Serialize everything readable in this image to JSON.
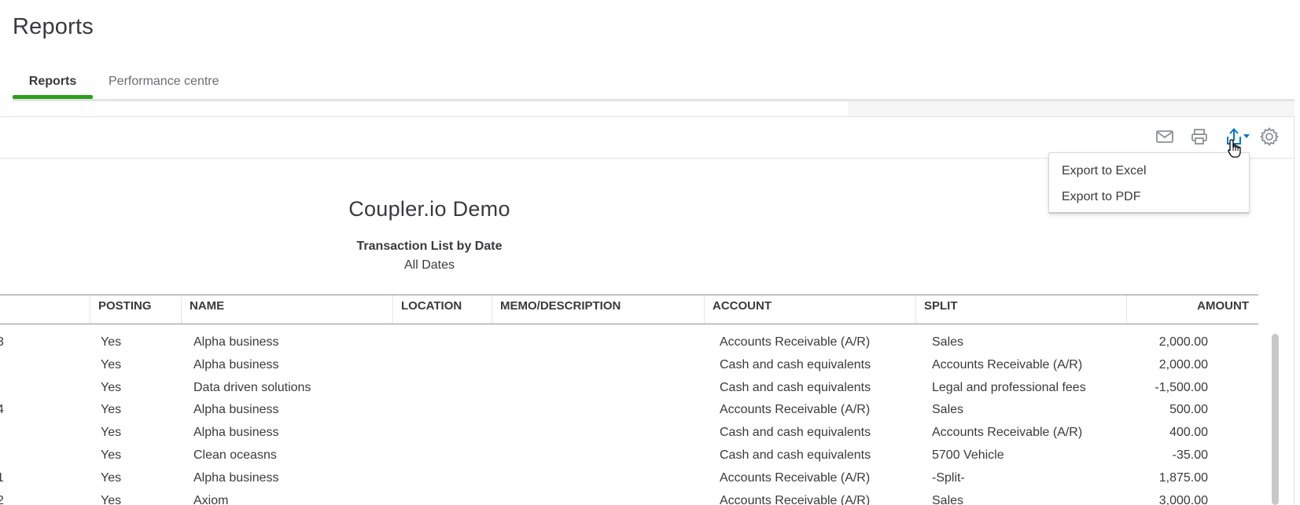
{
  "header": {
    "title": "Reports"
  },
  "tabs": [
    {
      "label": "Reports",
      "active": true
    },
    {
      "label": "Performance centre",
      "active": false
    }
  ],
  "toolbar": {
    "icons": [
      "mail-icon",
      "print-icon",
      "export-icon",
      "gear-icon"
    ]
  },
  "export_menu": {
    "items": [
      {
        "label": "Export to Excel"
      },
      {
        "label": "Export to PDF"
      }
    ]
  },
  "report": {
    "company": "Coupler.io Demo",
    "name": "Transaction List by Date",
    "range": "All Dates"
  },
  "table": {
    "columns": [
      "POSTING",
      "NAME",
      "LOCATION",
      "MEMO/DESCRIPTION",
      "ACCOUNT",
      "SPLIT",
      "AMOUNT"
    ],
    "rows": [
      {
        "date_fragment": "3",
        "posting": "Yes",
        "name": "Alpha business",
        "account": "Accounts Receivable (A/R)",
        "split": "Sales",
        "amount": "2,000.00"
      },
      {
        "date_fragment": "",
        "posting": "Yes",
        "name": "Alpha business",
        "account": "Cash and cash equivalents",
        "split": "Accounts Receivable (A/R)",
        "amount": "2,000.00"
      },
      {
        "date_fragment": "",
        "posting": "Yes",
        "name": "Data driven solutions",
        "account": "Cash and cash equivalents",
        "split": "Legal and professional fees",
        "amount": "-1,500.00"
      },
      {
        "date_fragment": "4",
        "posting": "Yes",
        "name": "Alpha business",
        "account": "Accounts Receivable (A/R)",
        "split": "Sales",
        "amount": "500.00"
      },
      {
        "date_fragment": "",
        "posting": "Yes",
        "name": "Alpha business",
        "account": "Cash and cash equivalents",
        "split": "Accounts Receivable (A/R)",
        "amount": "400.00"
      },
      {
        "date_fragment": "",
        "posting": "Yes",
        "name": "Clean oceasns",
        "account": "Cash and cash equivalents",
        "split": "5700 Vehicle",
        "amount": "-35.00"
      },
      {
        "date_fragment": "1",
        "posting": "Yes",
        "name": "Alpha business",
        "account": "Accounts Receivable (A/R)",
        "split": "-Split-",
        "amount": "1,875.00"
      },
      {
        "date_fragment": "2",
        "posting": "Yes",
        "name": "Axiom",
        "account": "Accounts Receivable (A/R)",
        "split": "Sales",
        "amount": "3,000.00"
      }
    ]
  },
  "colors": {
    "accent": "#2ca01c",
    "export_icon": "#0077c5",
    "text": "#393a3d",
    "muted_icon": "#8d9096"
  }
}
